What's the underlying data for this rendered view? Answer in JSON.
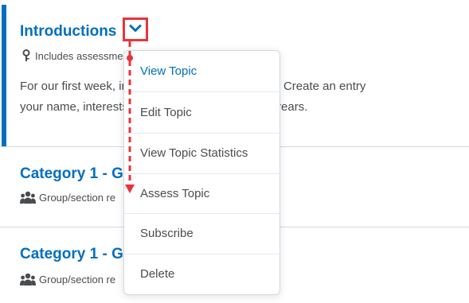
{
  "topics": [
    {
      "title": "Introductions",
      "meta": "Includes assessment",
      "description_line1": "For our first week, introduce yourself to the class. Create an entry",
      "description_line2": "your name, interests, and where you'll be in five years."
    },
    {
      "title": "Category 1 - G",
      "meta": "Group/section re"
    },
    {
      "title": "Category 1 - G",
      "meta": "Group/section re"
    }
  ],
  "menu": {
    "items": [
      {
        "label": "View Topic"
      },
      {
        "label": "Edit Topic"
      },
      {
        "label": "View Topic Statistics"
      },
      {
        "label": "Assess Topic"
      },
      {
        "label": "Subscribe"
      },
      {
        "label": "Delete"
      }
    ]
  },
  "colors": {
    "link": "#006fbf",
    "annotation": "#e8343c",
    "text": "#494c4e"
  },
  "icons": {
    "key": "key-icon",
    "group": "group-icon",
    "chevron": "chevron-down-icon"
  }
}
